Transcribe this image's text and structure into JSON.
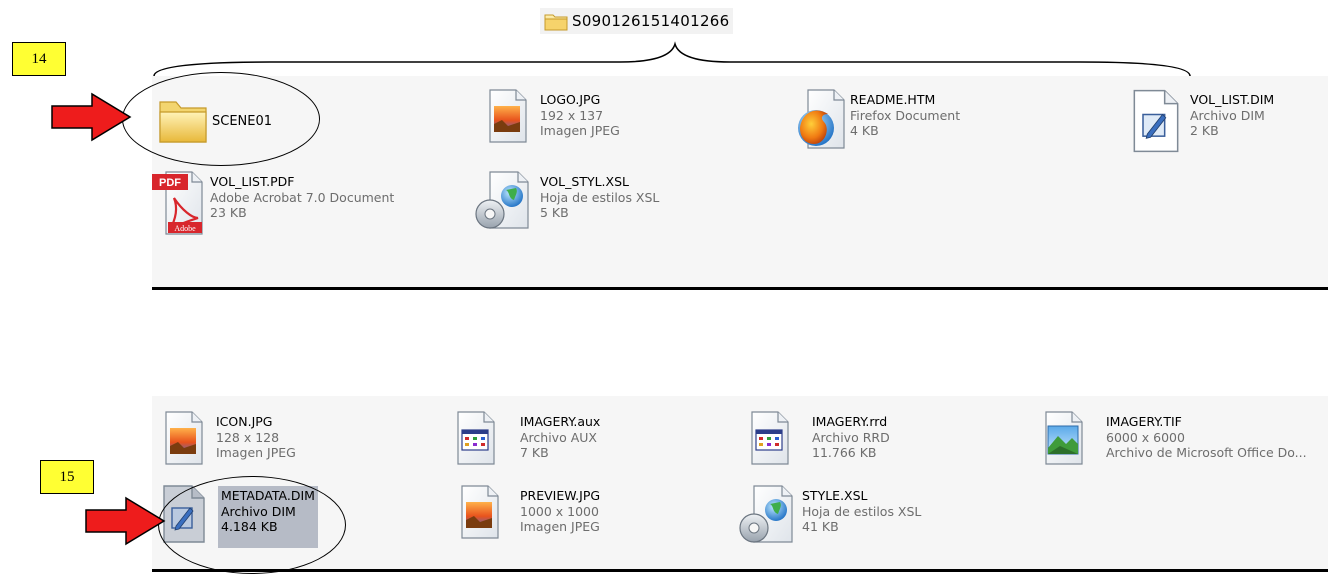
{
  "folder_title": "S090126151401266",
  "callouts": {
    "top": "14",
    "bottom": "15"
  },
  "top_files": [
    {
      "name": "SCENE01",
      "icon": "folder-icon"
    },
    {
      "name": "LOGO.JPG",
      "line2": "192 x 137",
      "line3": "Imagen JPEG",
      "icon": "jpeg-image-icon"
    },
    {
      "name": "README.HTM",
      "line2": "Firefox Document",
      "line3": "4 KB",
      "icon": "firefox-icon"
    },
    {
      "name": "VOL_LIST.DIM",
      "line2": "Archivo DIM",
      "line3": "2 KB",
      "icon": "dim-file-icon"
    },
    {
      "name": "VOL_LIST.PDF",
      "line2": "Adobe Acrobat 7.0 Document",
      "line3": "23 KB",
      "icon": "pdf-icon",
      "badge": "PDF",
      "brand": "Adobe"
    },
    {
      "name": "VOL_STYL.XSL",
      "line2": "Hoja de estilos XSL",
      "line3": "5 KB",
      "icon": "xsl-stylesheet-icon"
    }
  ],
  "bottom_files": [
    {
      "name": "ICON.JPG",
      "line2": "128 x 128",
      "line3": "Imagen JPEG",
      "icon": "jpeg-image-icon"
    },
    {
      "name": "IMAGERY.aux",
      "line2": "Archivo AUX",
      "line3": "7 KB",
      "icon": "aux-file-icon"
    },
    {
      "name": "IMAGERY.rrd",
      "line2": "Archivo RRD",
      "line3": "11.766 KB",
      "icon": "rrd-file-icon"
    },
    {
      "name": "IMAGERY.TIF",
      "line2": "6000 x 6000",
      "line3": "Archivo de Microsoft Office Do...",
      "icon": "tiff-image-icon"
    },
    {
      "name": "METADATA.DIM",
      "line2": "Archivo DIM",
      "line3": "4.184 KB",
      "icon": "dim-file-icon",
      "selected": true
    },
    {
      "name": "PREVIEW.JPG",
      "line2": "1000 x 1000",
      "line3": "Imagen JPEG",
      "icon": "jpeg-image-icon"
    },
    {
      "name": "STYLE.XSL",
      "line2": "Hoja de estilos XSL",
      "line3": "41 KB",
      "icon": "xsl-stylesheet-icon"
    }
  ],
  "colors": {
    "arrow": "#ee1c1c",
    "callout": "#ffff33",
    "selection": "#b6bbc6"
  }
}
